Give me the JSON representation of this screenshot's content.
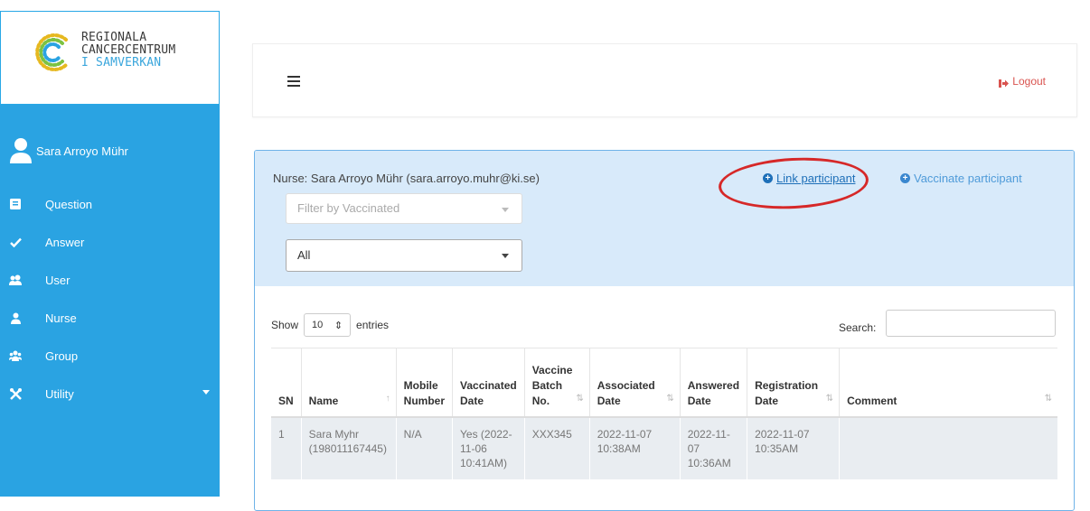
{
  "logo": {
    "line1": "REGIONALA",
    "line2": "CANCERCENTRUM",
    "line3": "I SAMVERKAN",
    "mark_colors": [
      "#e6b81f",
      "#7cc242",
      "#2aa3e2"
    ]
  },
  "sidebar": {
    "user_name": "Sara Arroyo Mühr",
    "items": [
      {
        "label": "Question",
        "icon": "list-icon"
      },
      {
        "label": "Answer",
        "icon": "check-icon"
      },
      {
        "label": "User",
        "icon": "users-icon"
      },
      {
        "label": "Nurse",
        "icon": "user-icon"
      },
      {
        "label": "Group",
        "icon": "group-icon"
      },
      {
        "label": "Utility",
        "icon": "tools-icon"
      }
    ],
    "bg_color": "#2aa3e2"
  },
  "header": {
    "logout_label": "Logout"
  },
  "panel": {
    "nurse_line": "Nurse: Sara Arroyo Mühr (sara.arroyo.muhr@ki.se)",
    "link_participant": "Link participant",
    "vaccinate_participant": "Vaccinate participant",
    "filter_placeholder": "Filter by Vaccinated",
    "filter_value": "All"
  },
  "table_controls": {
    "show_label": "Show",
    "entries_value": "10",
    "entries_label": "entries",
    "search_label": "Search:"
  },
  "table": {
    "headers": [
      "SN",
      "Name",
      "Mobile Number",
      "Vaccinated Date",
      "Vaccine Batch No.",
      "Associated Date",
      "Answered Date",
      "Registration Date",
      "Comment"
    ],
    "rows": [
      {
        "sn": "1",
        "name": "Sara Myhr (198011167445)",
        "mobile": "N/A",
        "vaccinated": "Yes (2022-11-06 10:41AM)",
        "batch": "XXX345",
        "associated": "2022-11-07 10:38AM",
        "answered": "2022-11-07 10:36AM",
        "registration": "2022-11-07 10:35AM",
        "comment": ""
      }
    ]
  }
}
